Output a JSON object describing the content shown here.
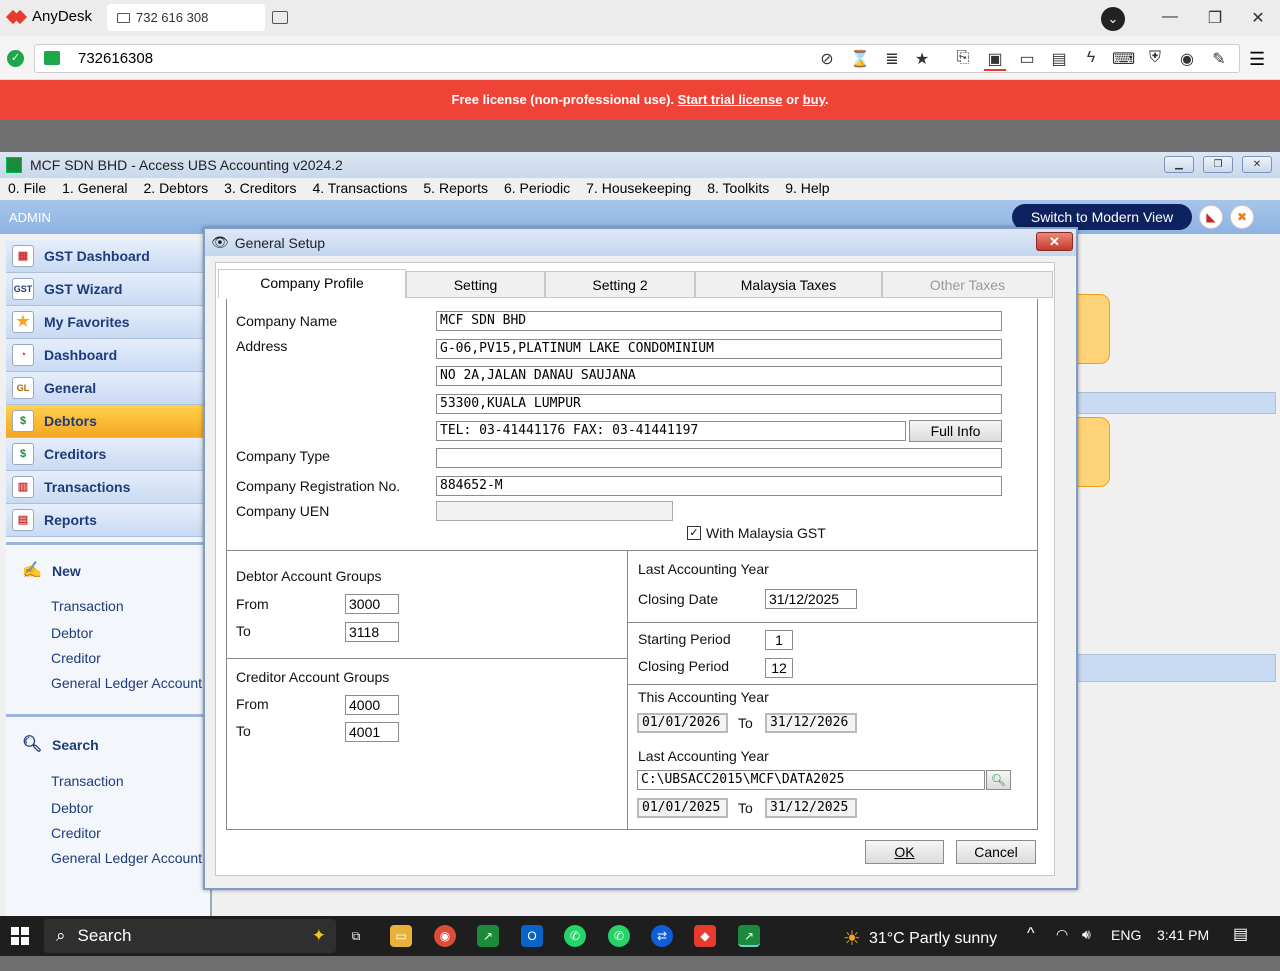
{
  "anydesk": {
    "app_name": "AnyDesk",
    "tab_label": "732 616 308",
    "address_id": "732616308",
    "banner": {
      "text": "Free license (non-professional use).",
      "trial": "Start trial license",
      "or": "or",
      "buy": "buy",
      "end": "."
    }
  },
  "app": {
    "title": "MCF SDN BHD - Access UBS Accounting v2024.2",
    "menu": [
      "0. File",
      "1. General",
      "2. Debtors",
      "3. Creditors",
      "4. Transactions",
      "5. Reports",
      "6. Periodic",
      "7. Housekeeping",
      "8. Toolkits",
      "9. Help"
    ],
    "user": "ADMIN",
    "modern_view": "Switch to Modern View"
  },
  "sidebar": {
    "items": [
      {
        "label": "GST Dashboard",
        "icon": "gst-dashboard-icon"
      },
      {
        "label": "GST Wizard",
        "icon": "gst-wizard-icon"
      },
      {
        "label": "My Favorites",
        "icon": "star-icon"
      },
      {
        "label": "Dashboard",
        "icon": "dashboard-icon"
      },
      {
        "label": "General",
        "icon": "general-ledger-icon"
      },
      {
        "label": "Debtors",
        "icon": "debtors-icon"
      },
      {
        "label": "Creditors",
        "icon": "creditors-icon"
      },
      {
        "label": "Transactions",
        "icon": "transactions-icon"
      },
      {
        "label": "Reports",
        "icon": "reports-icon"
      }
    ],
    "new": {
      "title": "New",
      "links": [
        "Transaction",
        "Debtor",
        "Creditor",
        "General Ledger Account"
      ]
    },
    "search": {
      "title": "Search",
      "links": [
        "Transaction",
        "Debtor",
        "Creditor",
        "General Ledger Account"
      ]
    }
  },
  "dialog": {
    "title": "General Setup",
    "tabs": [
      "Company Profile",
      "Setting",
      "Setting 2",
      "Malaysia Taxes",
      "Other Taxes"
    ],
    "profile": {
      "company_name_label": "Company Name",
      "company_name": "MCF SDN BHD",
      "address_label": "Address",
      "address": [
        "G-06,PV15,PLATINUM LAKE CONDOMINIUM",
        "NO 2A,JALAN DANAU SAUJANA",
        "53300,KUALA LUMPUR",
        "TEL: 03-41441176  FAX: 03-41441197"
      ],
      "full_info": "Full Info",
      "company_type_label": "Company Type",
      "company_type": "",
      "reg_no_label": "Company Registration No.",
      "reg_no": "884652-M",
      "uen_label": "Company UEN",
      "uen": "",
      "gst_label": "With Malaysia GST",
      "gst_checked": true
    },
    "debtor_groups": {
      "title": "Debtor Account Groups",
      "from_label": "From",
      "from": "3000",
      "to_label": "To",
      "to": "3118"
    },
    "creditor_groups": {
      "title": "Creditor Account Groups",
      "from_label": "From",
      "from": "4000",
      "to_label": "To",
      "to": "4001"
    },
    "last_year": {
      "title": "Last Accounting Year",
      "closing_label": "Closing Date",
      "closing_date": "31/12/2025"
    },
    "periods": {
      "start_label": "Starting Period",
      "start": "1",
      "close_label": "Closing Period",
      "close": "12"
    },
    "this_year": {
      "title": "This Accounting Year",
      "from": "01/01/2026",
      "to_label": "To",
      "to": "31/12/2026"
    },
    "last_year2": {
      "title": "Last Accounting Year",
      "path": "C:\\UBSACC2015\\MCF\\DATA2025",
      "from": "01/01/2025",
      "to_label": "To",
      "to": "31/12/2025"
    },
    "ok": "OK",
    "cancel": "Cancel"
  },
  "taskbar": {
    "search": "Search",
    "weather": "31°C  Partly sunny",
    "lang": "ENG",
    "time": "3:41 PM"
  }
}
